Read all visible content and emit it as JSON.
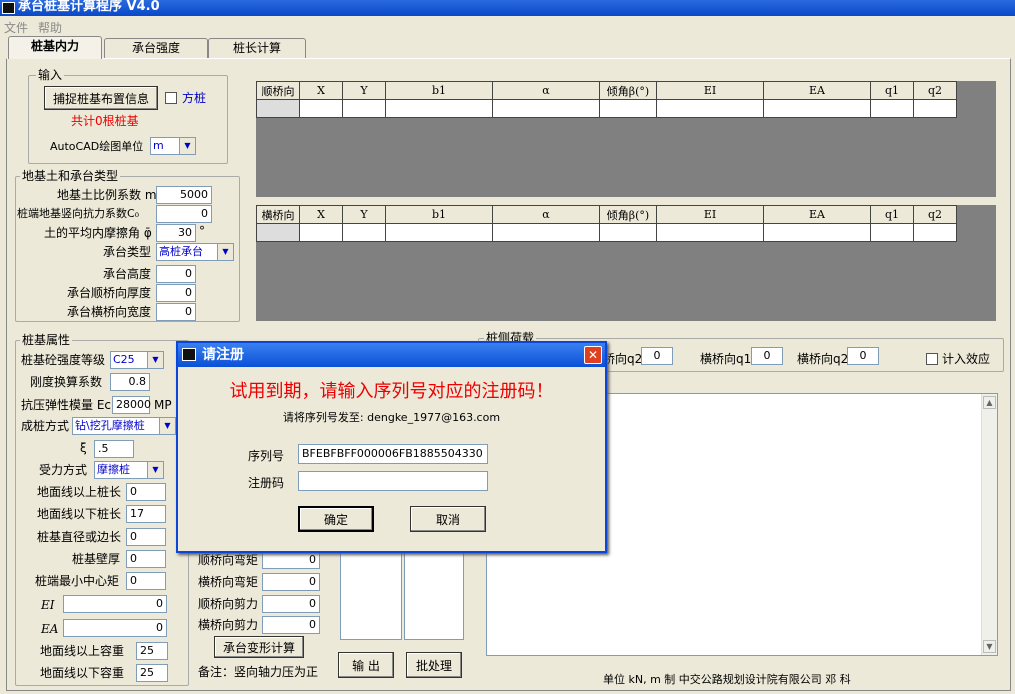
{
  "window": {
    "title": "承台桩基计算程序 V4.0"
  },
  "menu": [
    "文件",
    "帮助"
  ],
  "tabs": [
    "桩基内力",
    "承台强度",
    "桩长计算"
  ],
  "input_group": {
    "legend": "输入",
    "capture_button": "捕捉桩基布置信息",
    "square_pile_label": "方桩",
    "pile_count": "共计0根桩基",
    "cad_unit_label": "AutoCAD绘图单位",
    "cad_unit_value": "m"
  },
  "soil_group": {
    "legend": "地基土和承台类型",
    "m_label": "地基土比例系数 m",
    "m_value": "5000",
    "c0_label": "桩端地基竖向抗力系数C₀",
    "c0_value": "0",
    "phi_label": "土的平均内摩擦角 φ̄",
    "phi_value": "30",
    "phi_unit": "°",
    "cap_type_label": "承台类型",
    "cap_type_value": "高桩承台",
    "cap_height_label": "承台高度",
    "cap_height_value": "0",
    "cap_long_label": "承台顺桥向厚度",
    "cap_long_value": "0",
    "cap_trans_label": "承台横桥向宽度",
    "cap_trans_value": "0"
  },
  "table_long": {
    "headers": [
      "顺桥向",
      "X",
      "Y",
      "b1",
      "α",
      "倾角β(°)",
      "EI",
      "EA",
      "q1",
      "q2"
    ]
  },
  "table_trans": {
    "headers": [
      "横桥向",
      "X",
      "Y",
      "b1",
      "α",
      "倾角β(°)",
      "EI",
      "EA",
      "q1",
      "q2"
    ]
  },
  "pile_props": {
    "legend": "桩基属性",
    "concrete_label": "桩基砼强度等级",
    "concrete_value": "C25",
    "stiffness_label": "刚度换算系数",
    "stiffness_value": "0.8",
    "ec_label": "抗压弹性模量 Ec",
    "ec_value": "28000",
    "ec_unit": "MP",
    "method_label": "成桩方式",
    "method_value": "钻\\挖孔摩擦桩",
    "xi_label": "ξ",
    "xi_value": ".5",
    "force_label": "受力方式",
    "force_value": "摩擦桩",
    "above_len_label": "地面线以上桩长",
    "above_len_value": "0",
    "below_len_label": "地面线以下桩长",
    "below_len_value": "17",
    "diameter_label": "桩基直径或边长",
    "diameter_value": "0",
    "wall_label": "桩基壁厚",
    "wall_value": "0",
    "min_dist_label": "桩端最小中心矩",
    "min_dist_value": "0",
    "ei_label": "EI",
    "ei_value": "0",
    "ea_label": "EA",
    "ea_value": "0",
    "above_weight_label": "地面线以上容重",
    "above_weight_value": "25",
    "below_weight_label": "地面线以下容重",
    "below_weight_value": "25"
  },
  "loads": {
    "long_moment_label": "顺桥向弯矩",
    "long_moment_value": "0",
    "trans_moment_label": "横桥向弯矩",
    "trans_moment_value": "0",
    "long_shear_label": "顺桥向剪力",
    "long_shear_value": "0",
    "trans_shear_label": "横桥向剪力",
    "trans_shear_value": "0",
    "deform_button": "承台变形计算",
    "note": "备注：竖向轴力压为正"
  },
  "side_load": {
    "legend": "桩侧荷载",
    "q2_long_label": "桥向q2",
    "q2_long_value": "0",
    "q1_trans_label": "横桥向q1",
    "q1_trans_value": "0",
    "q2_trans_label": "横桥向q2",
    "q2_trans_value": "0",
    "effect_label": "计入效应"
  },
  "actions": {
    "output_button": "输 出",
    "batch_button": "批处理"
  },
  "footer": "单位  kN, m 制     中交公路规划设计院有限公司  邓   科",
  "dialog": {
    "title": "请注册",
    "message": "试用到期，请输入序列号对应的注册码！",
    "send_to": "请将序列号发至: dengke_1977@163.com",
    "serial_label": "序列号",
    "serial_value": "BFEBFBFF000006FB1885504330",
    "regcode_label": "注册码",
    "regcode_value": "",
    "ok_button": "确定",
    "cancel_button": "取消"
  }
}
